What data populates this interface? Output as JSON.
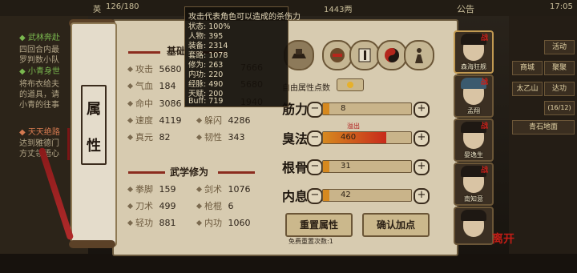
{
  "topbar": {
    "left_label": "英",
    "progress": "126/180",
    "currency": "1443两",
    "notice": "公告",
    "time": "17:05"
  },
  "left_panel": {
    "lines": [
      {
        "text": "◆ 武林奔赴",
        "style": "g"
      },
      {
        "text": "四回合内最",
        "style": ""
      },
      {
        "text": "罗判数小队",
        "style": ""
      },
      {
        "text": "◆ 小青身世",
        "style": "g"
      },
      {
        "text": "将布衣给夫",
        "style": ""
      },
      {
        "text": "的道具，请",
        "style": ""
      },
      {
        "text": "小青的往事",
        "style": ""
      },
      {
        "text": "◆ 天天绝路",
        "style": "r"
      },
      {
        "text": "达到雅德门",
        "style": ""
      },
      {
        "text": "方丈领悟心",
        "style": ""
      }
    ]
  },
  "right_menu": {
    "buttons": [
      "活动",
      "聚聚",
      "商城",
      "达功",
      "太乙山",
      "(16/12)",
      "青石地面"
    ]
  },
  "scroll": {
    "title_line1": "属",
    "title_line2": "性"
  },
  "tooltip": {
    "header": "攻击代表角色可以造成的杀伤力",
    "rows": [
      "状态: 100%",
      "人物: 395",
      "装备: 2314",
      "套路: 1078",
      "修为: 263",
      "内功: 220",
      "经脉: 490",
      "天赋: 200",
      "Buff: 719"
    ]
  },
  "basic": {
    "title": "基础",
    "stats": [
      {
        "label": "攻击",
        "value": "5680",
        "pos": "l1"
      },
      {
        "label": "",
        "value": "7666",
        "pos": "r1"
      },
      {
        "label": "气血",
        "value": "184",
        "pos": "l2"
      },
      {
        "label": "",
        "value": "5680",
        "pos": "r2"
      },
      {
        "label": "命中",
        "value": "3086",
        "pos": "l3"
      },
      {
        "label": "",
        "value": "1940",
        "pos": "r3"
      },
      {
        "label": "速度",
        "value": "4119",
        "pos": "l4"
      },
      {
        "label": "躲闪",
        "value": "4286",
        "pos": "r4"
      },
      {
        "label": "真元",
        "value": "82",
        "pos": "l5"
      },
      {
        "label": "韧性",
        "value": "343",
        "pos": "r5"
      }
    ]
  },
  "martial": {
    "title": "武学修为",
    "stats": [
      {
        "label": "拳脚",
        "value": "159"
      },
      {
        "label": "剑术",
        "value": "1076"
      },
      {
        "label": "刀术",
        "value": "499"
      },
      {
        "label": "枪棍",
        "value": "6"
      },
      {
        "label": "轻功",
        "value": "881"
      },
      {
        "label": "内功",
        "value": "1060"
      }
    ]
  },
  "free_points": {
    "label": "自由属性点数"
  },
  "attributes": [
    {
      "name": "筋力",
      "value": "8",
      "fill": 0.07,
      "red": false
    },
    {
      "name": "臭法",
      "value": "460",
      "fill": 0.72,
      "red": true
    },
    {
      "name": "根骨",
      "value": "31",
      "fill": 0.07,
      "red": false
    },
    {
      "name": "内息",
      "value": "42",
      "fill": 0.07,
      "red": false
    }
  ],
  "overflow_label": "溢出",
  "buttons": {
    "reset": "重置属性",
    "confirm": "确认加点",
    "reset_count": "免费重置次数:1"
  },
  "portraits": [
    {
      "name": "森海狂舰",
      "battle": "战"
    },
    {
      "name": "孟翔",
      "battle": "战"
    },
    {
      "name": "晏逸生",
      "battle": "战"
    },
    {
      "name": "南知意",
      "battle": "战"
    },
    {
      "name": "",
      "battle": ""
    }
  ],
  "depart_label": "离开"
}
